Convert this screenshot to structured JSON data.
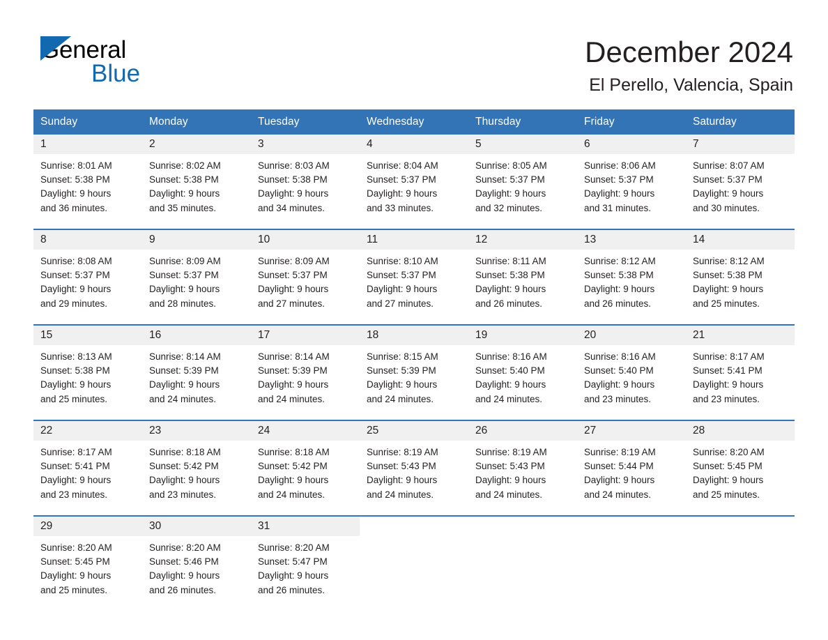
{
  "brand": {
    "word_general": "General",
    "word_blue": "Blue",
    "logo_color": "#1269b0"
  },
  "header": {
    "month_title": "December 2024",
    "location": "El Perello, Valencia, Spain"
  },
  "theme": {
    "header_blue": "#3274b5",
    "daynum_band": "#f0f0f0",
    "text": "#231f20"
  },
  "calendar": {
    "weekday_headers": [
      "Sunday",
      "Monday",
      "Tuesday",
      "Wednesday",
      "Thursday",
      "Friday",
      "Saturday"
    ],
    "weeks": [
      [
        {
          "day": "1",
          "lines": [
            "Sunrise: 8:01 AM",
            "Sunset: 5:38 PM",
            "Daylight: 9 hours",
            "and 36 minutes."
          ]
        },
        {
          "day": "2",
          "lines": [
            "Sunrise: 8:02 AM",
            "Sunset: 5:38 PM",
            "Daylight: 9 hours",
            "and 35 minutes."
          ]
        },
        {
          "day": "3",
          "lines": [
            "Sunrise: 8:03 AM",
            "Sunset: 5:38 PM",
            "Daylight: 9 hours",
            "and 34 minutes."
          ]
        },
        {
          "day": "4",
          "lines": [
            "Sunrise: 8:04 AM",
            "Sunset: 5:37 PM",
            "Daylight: 9 hours",
            "and 33 minutes."
          ]
        },
        {
          "day": "5",
          "lines": [
            "Sunrise: 8:05 AM",
            "Sunset: 5:37 PM",
            "Daylight: 9 hours",
            "and 32 minutes."
          ]
        },
        {
          "day": "6",
          "lines": [
            "Sunrise: 8:06 AM",
            "Sunset: 5:37 PM",
            "Daylight: 9 hours",
            "and 31 minutes."
          ]
        },
        {
          "day": "7",
          "lines": [
            "Sunrise: 8:07 AM",
            "Sunset: 5:37 PM",
            "Daylight: 9 hours",
            "and 30 minutes."
          ]
        }
      ],
      [
        {
          "day": "8",
          "lines": [
            "Sunrise: 8:08 AM",
            "Sunset: 5:37 PM",
            "Daylight: 9 hours",
            "and 29 minutes."
          ]
        },
        {
          "day": "9",
          "lines": [
            "Sunrise: 8:09 AM",
            "Sunset: 5:37 PM",
            "Daylight: 9 hours",
            "and 28 minutes."
          ]
        },
        {
          "day": "10",
          "lines": [
            "Sunrise: 8:09 AM",
            "Sunset: 5:37 PM",
            "Daylight: 9 hours",
            "and 27 minutes."
          ]
        },
        {
          "day": "11",
          "lines": [
            "Sunrise: 8:10 AM",
            "Sunset: 5:37 PM",
            "Daylight: 9 hours",
            "and 27 minutes."
          ]
        },
        {
          "day": "12",
          "lines": [
            "Sunrise: 8:11 AM",
            "Sunset: 5:38 PM",
            "Daylight: 9 hours",
            "and 26 minutes."
          ]
        },
        {
          "day": "13",
          "lines": [
            "Sunrise: 8:12 AM",
            "Sunset: 5:38 PM",
            "Daylight: 9 hours",
            "and 26 minutes."
          ]
        },
        {
          "day": "14",
          "lines": [
            "Sunrise: 8:12 AM",
            "Sunset: 5:38 PM",
            "Daylight: 9 hours",
            "and 25 minutes."
          ]
        }
      ],
      [
        {
          "day": "15",
          "lines": [
            "Sunrise: 8:13 AM",
            "Sunset: 5:38 PM",
            "Daylight: 9 hours",
            "and 25 minutes."
          ]
        },
        {
          "day": "16",
          "lines": [
            "Sunrise: 8:14 AM",
            "Sunset: 5:39 PM",
            "Daylight: 9 hours",
            "and 24 minutes."
          ]
        },
        {
          "day": "17",
          "lines": [
            "Sunrise: 8:14 AM",
            "Sunset: 5:39 PM",
            "Daylight: 9 hours",
            "and 24 minutes."
          ]
        },
        {
          "day": "18",
          "lines": [
            "Sunrise: 8:15 AM",
            "Sunset: 5:39 PM",
            "Daylight: 9 hours",
            "and 24 minutes."
          ]
        },
        {
          "day": "19",
          "lines": [
            "Sunrise: 8:16 AM",
            "Sunset: 5:40 PM",
            "Daylight: 9 hours",
            "and 24 minutes."
          ]
        },
        {
          "day": "20",
          "lines": [
            "Sunrise: 8:16 AM",
            "Sunset: 5:40 PM",
            "Daylight: 9 hours",
            "and 23 minutes."
          ]
        },
        {
          "day": "21",
          "lines": [
            "Sunrise: 8:17 AM",
            "Sunset: 5:41 PM",
            "Daylight: 9 hours",
            "and 23 minutes."
          ]
        }
      ],
      [
        {
          "day": "22",
          "lines": [
            "Sunrise: 8:17 AM",
            "Sunset: 5:41 PM",
            "Daylight: 9 hours",
            "and 23 minutes."
          ]
        },
        {
          "day": "23",
          "lines": [
            "Sunrise: 8:18 AM",
            "Sunset: 5:42 PM",
            "Daylight: 9 hours",
            "and 23 minutes."
          ]
        },
        {
          "day": "24",
          "lines": [
            "Sunrise: 8:18 AM",
            "Sunset: 5:42 PM",
            "Daylight: 9 hours",
            "and 24 minutes."
          ]
        },
        {
          "day": "25",
          "lines": [
            "Sunrise: 8:19 AM",
            "Sunset: 5:43 PM",
            "Daylight: 9 hours",
            "and 24 minutes."
          ]
        },
        {
          "day": "26",
          "lines": [
            "Sunrise: 8:19 AM",
            "Sunset: 5:43 PM",
            "Daylight: 9 hours",
            "and 24 minutes."
          ]
        },
        {
          "day": "27",
          "lines": [
            "Sunrise: 8:19 AM",
            "Sunset: 5:44 PM",
            "Daylight: 9 hours",
            "and 24 minutes."
          ]
        },
        {
          "day": "28",
          "lines": [
            "Sunrise: 8:20 AM",
            "Sunset: 5:45 PM",
            "Daylight: 9 hours",
            "and 25 minutes."
          ]
        }
      ],
      [
        {
          "day": "29",
          "lines": [
            "Sunrise: 8:20 AM",
            "Sunset: 5:45 PM",
            "Daylight: 9 hours",
            "and 25 minutes."
          ]
        },
        {
          "day": "30",
          "lines": [
            "Sunrise: 8:20 AM",
            "Sunset: 5:46 PM",
            "Daylight: 9 hours",
            "and 26 minutes."
          ]
        },
        {
          "day": "31",
          "lines": [
            "Sunrise: 8:20 AM",
            "Sunset: 5:47 PM",
            "Daylight: 9 hours",
            "and 26 minutes."
          ]
        },
        {
          "day": "",
          "lines": []
        },
        {
          "day": "",
          "lines": []
        },
        {
          "day": "",
          "lines": []
        },
        {
          "day": "",
          "lines": []
        }
      ]
    ]
  }
}
